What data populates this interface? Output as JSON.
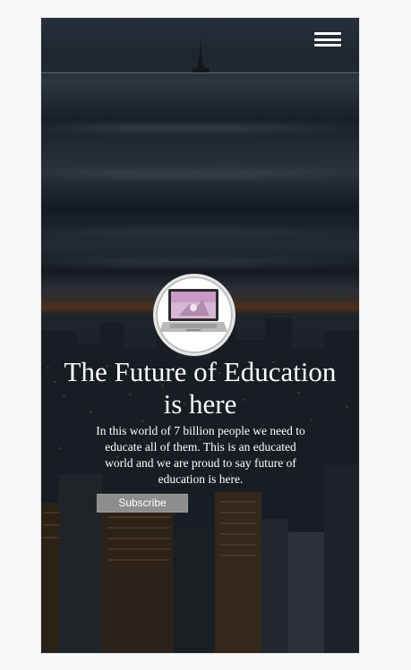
{
  "header": {
    "menu_icon": "hamburger-menu-icon"
  },
  "hero": {
    "logo_icon": "laptop-icon",
    "title": "The Future of Education is here",
    "description": "In this world of 7 billion people we need to educate all of them. This is an educated world and we are proud to say future of education is here.",
    "subscribe_label": "Subscribe"
  },
  "colors": {
    "page_background": "#f8f8f8",
    "hero_text": "#ffffff",
    "button_background": "#8d8d8d",
    "button_text": "#ffffff"
  }
}
